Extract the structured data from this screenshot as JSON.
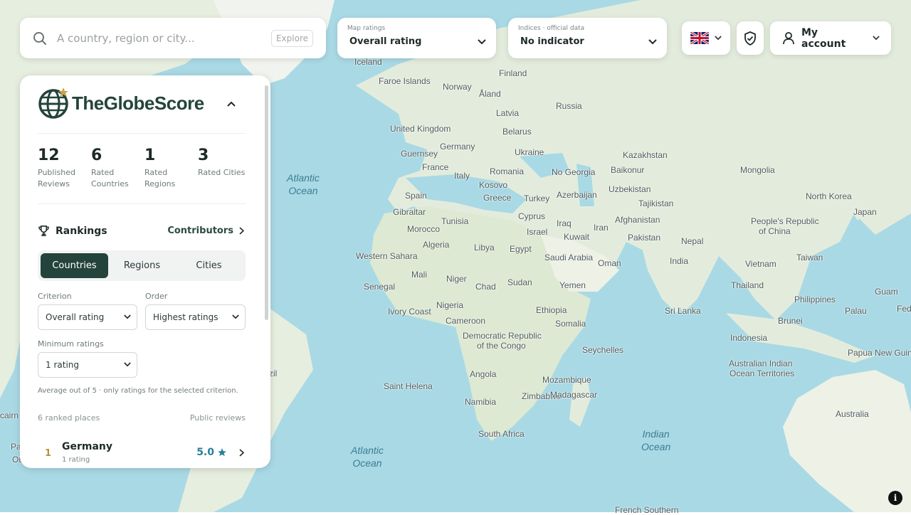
{
  "search": {
    "placeholder": "A country, region or city...",
    "explore_label": "Explore"
  },
  "map_ratings": {
    "caption": "Map ratings",
    "value": "Overall rating"
  },
  "indices": {
    "caption": "Indices · official data",
    "value": "No indicator"
  },
  "account": {
    "label": "My account"
  },
  "brand": {
    "name": "TheGlobeScore",
    "color": "#24443b",
    "accent": "#c9a24b"
  },
  "stats": [
    {
      "value": "12",
      "label_line1": "Published",
      "label_line2": "Reviews"
    },
    {
      "value": "6",
      "label_line1": "Rated",
      "label_line2": "Countries"
    },
    {
      "value": "1",
      "label_line1": "Rated",
      "label_line2": "Regions"
    },
    {
      "value": "3",
      "label_line1": "Rated Cities",
      "label_line2": ""
    }
  ],
  "rankings": {
    "title": "Rankings",
    "contributors_label": "Contributors",
    "tabs": [
      "Countries",
      "Regions",
      "Cities"
    ],
    "active_tab": "Countries",
    "criterion_caption": "Criterion",
    "criterion_value": "Overall rating",
    "order_caption": "Order",
    "order_value": "Highest ratings",
    "min_caption": "Minimum ratings",
    "min_value": "1 rating",
    "note": "Average out of 5 · only ratings for the selected criterion.",
    "ranked_count": "6 ranked places",
    "public_reviews": "Public reviews",
    "items": [
      {
        "rank": "1",
        "name": "Germany",
        "sub": "1 rating",
        "score": "5.0"
      }
    ]
  },
  "map": {
    "countries": [
      "Iceland",
      "Finland",
      "Faroe Islands",
      "Norway",
      "Åland",
      "Russia",
      "Latvia",
      "United Kingdom",
      "Belarus",
      "Germany",
      "Guernsey",
      "Ukraine",
      "Kazakhstan",
      "France",
      "Romania",
      "Mongolia",
      "Italy",
      "Baikonur",
      "Kosovo",
      "No Georgia",
      "Uzbekistan",
      "Spain",
      "Greece",
      "Turkey",
      "Azerbaijan",
      "Tajikistan",
      "North Korea",
      "Gibraltar",
      "Cyprus",
      "Japan",
      "Tunisia",
      "Afghanistan",
      "People's Republic",
      "of China",
      "Morocco",
      "Israel",
      "Iraq",
      "Iran",
      "Kuwait",
      "Pakistan",
      "Algeria",
      "Libya",
      "Egypt",
      "Nepal",
      "Western Sahara",
      "Saudi Arabia",
      "Oman",
      "India",
      "Taiwan",
      "Vietnam",
      "Mali",
      "Niger",
      "Senegal",
      "Chad",
      "Sudan",
      "Yemen",
      "Thailand",
      "Philippines",
      "Guam",
      "Ivory Coast",
      "Nigeria",
      "Ethiopia",
      "Sri Lanka",
      "Palau",
      "Brunei",
      "Cameroon",
      "Somalia",
      "Democratic Republic",
      "of the Congo",
      "Indonesia",
      "Seychelles",
      "Papua New Guin",
      "Australian Indian",
      "Ocean Territories",
      "Angola",
      "Mozambique",
      "Saint Helena",
      "Zimbabwe",
      "Madagascar",
      "Namibia",
      "Australia",
      "South Africa",
      "French Southern",
      "Fed",
      "zil",
      "cairn",
      "Pa",
      "Ou"
    ],
    "oceans": [
      "Atlantic Ocean",
      "Atlantic Ocean",
      "Indian Ocean"
    ],
    "water_color": "#aadae6",
    "land_color": "#e8efe2"
  }
}
